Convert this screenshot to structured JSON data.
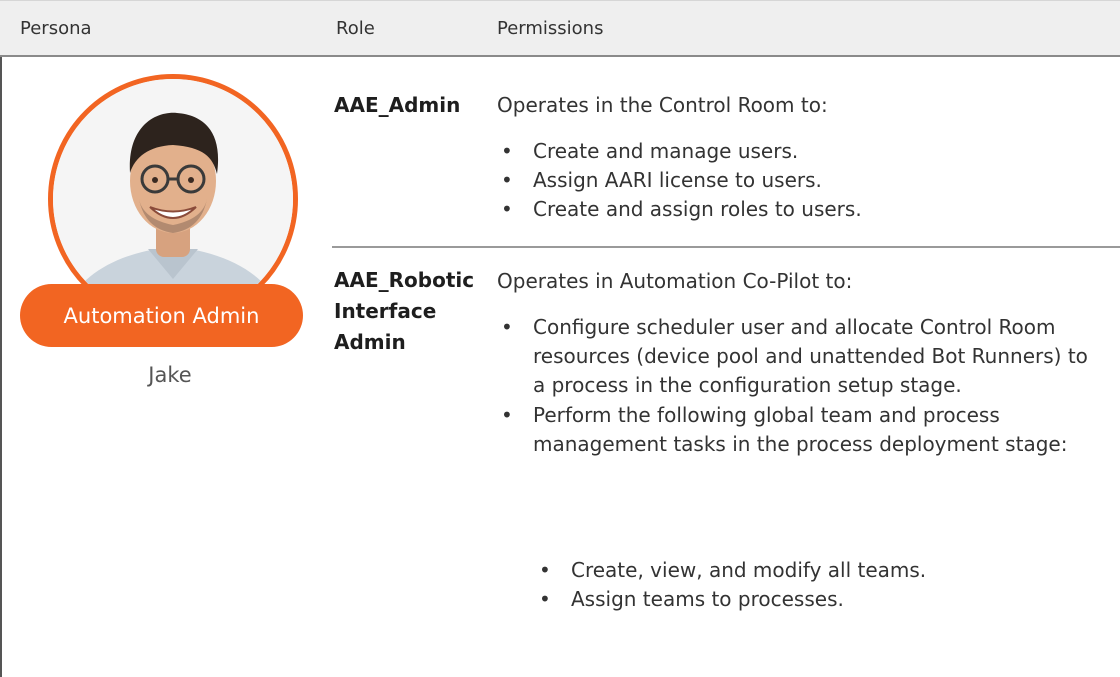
{
  "header": {
    "persona": "Persona",
    "role": "Role",
    "permissions": "Permissions"
  },
  "persona": {
    "badge": "Automation Admin",
    "name": "Jake"
  },
  "rows": [
    {
      "role": "AAE_Admin",
      "intro": "Operates in the Control Room to:",
      "bullets": [
        "Create and manage users.",
        "Assign AARI license to users.",
        "Create and assign roles to users."
      ]
    },
    {
      "role_lines": [
        "AAE_Robotic",
        "Interface",
        "Admin"
      ],
      "intro": "Operates in Automation Co-Pilot to:",
      "bullets": [
        "Configure scheduler user and allocate Control Room resources (device pool and unattended Bot Runners) to a process in the configuration setup stage.",
        "Perform the following global team and process management tasks in the process deployment stage:"
      ],
      "sub_bullets": [
        "Create, view, and modify all teams.",
        "Assign teams to processes."
      ]
    }
  ],
  "colors": {
    "accent": "#f26522",
    "header_bg": "#efefef"
  },
  "icons": {
    "avatar": "person-avatar-icon"
  }
}
